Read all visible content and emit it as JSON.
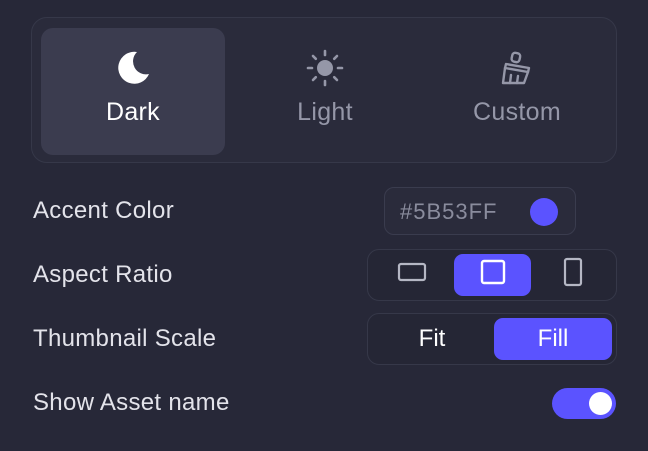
{
  "theme": {
    "options": [
      {
        "label": "Dark",
        "icon": "moon-icon",
        "selected": true
      },
      {
        "label": "Light",
        "icon": "sun-icon",
        "selected": false
      },
      {
        "label": "Custom",
        "icon": "brush-icon",
        "selected": false
      }
    ]
  },
  "settings": {
    "accent_color": {
      "label": "Accent Color",
      "value": "#5B53FF"
    },
    "aspect_ratio": {
      "label": "Aspect Ratio",
      "options": [
        {
          "icon": "landscape-icon",
          "selected": false
        },
        {
          "icon": "square-icon",
          "selected": true
        },
        {
          "icon": "portrait-icon",
          "selected": false
        }
      ]
    },
    "thumbnail_scale": {
      "label": "Thumbnail Scale",
      "options": [
        {
          "label": "Fit",
          "selected": false
        },
        {
          "label": "Fill",
          "selected": true
        }
      ]
    },
    "show_asset_name": {
      "label": "Show Asset name",
      "enabled": true
    }
  },
  "colors": {
    "accent": "#5B53FF",
    "background": "#272838",
    "selected_tile": "#3B3C4F"
  }
}
